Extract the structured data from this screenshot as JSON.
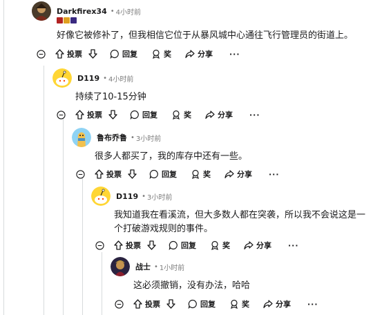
{
  "actions": {
    "upvote_label": "投票",
    "reply_label": "回复",
    "award_label": "奖",
    "share_label": "分享",
    "more_label": "···"
  },
  "comments": [
    {
      "author": "Darkfirex34",
      "time": "4小时前",
      "dot": "•",
      "text": "好像它被修补了，但我相信它位于从暴风城中心通往飞行管理员的街道上。"
    },
    {
      "author": "D119",
      "time": "4小时前",
      "dot": "•",
      "text": "持续了10-15分钟"
    },
    {
      "author": "鲁布乔鲁",
      "time": "3小时前",
      "dot": "•",
      "text": "很多人都买了，我的库存中还有一些。"
    },
    {
      "author": "D119",
      "time": "3小时前",
      "dot": "•",
      "text": "我知道我在看溪流，但大多数人都在突袭，所以我不会说这是一个打破游戏规则的事件。"
    },
    {
      "author": "战士",
      "time": "1小时前",
      "dot": "•",
      "text": "这必须撤销，没有办法，哈哈"
    }
  ],
  "colors": {
    "avatar_yellow": "#ffd635",
    "thread_line": "#d7dadc",
    "meta_gray": "#7c7c7c"
  }
}
